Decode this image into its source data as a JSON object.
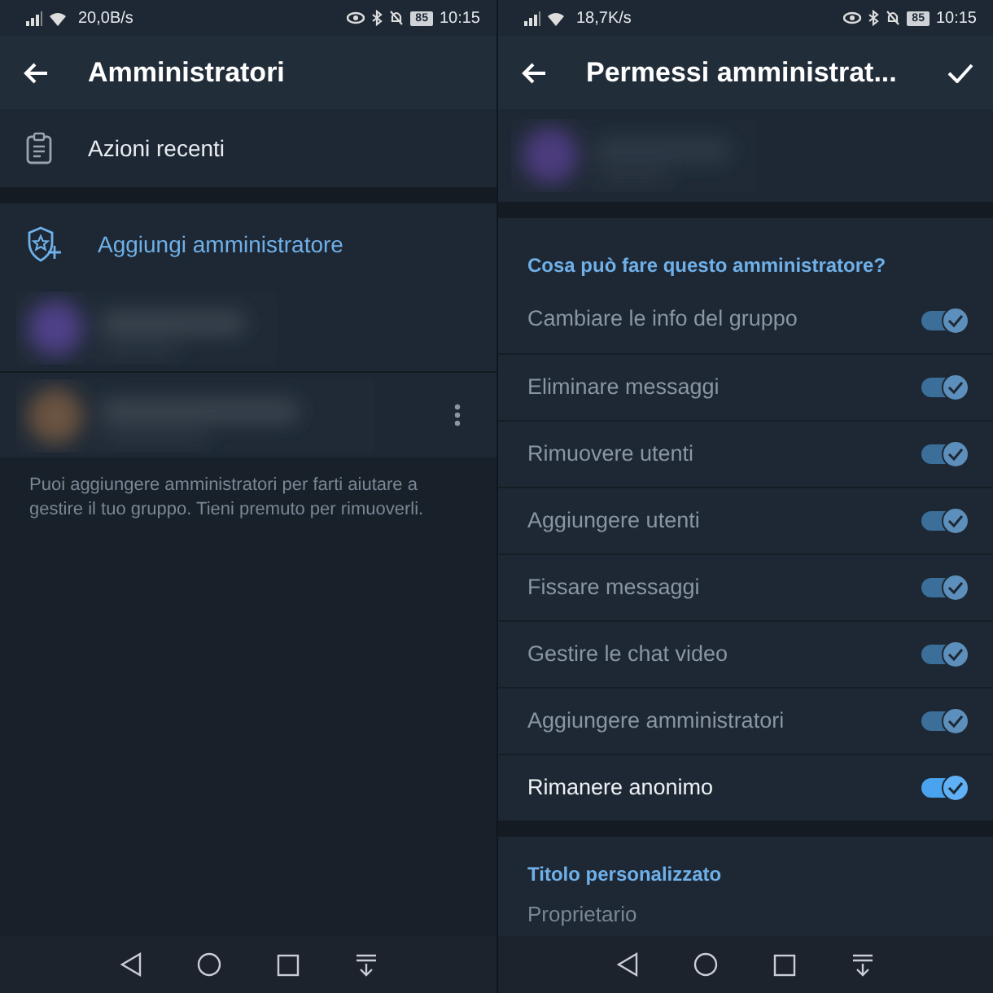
{
  "screens": [
    {
      "status_bar": {
        "speed": "20,0B/s",
        "battery": "85",
        "time": "10:15"
      },
      "header": {
        "title": "Amministratori",
        "confirm": false
      },
      "recent_actions": {
        "label": "Azioni recenti"
      },
      "add_admin": {
        "label": "Aggiungi amministratore"
      },
      "admins": [
        {
          "kind": "picture",
          "has_menu": false
        },
        {
          "kind": "picture",
          "has_menu": true
        }
      ],
      "hint": "Puoi aggiungere amministratori per farti aiutare a gestire il tuo gruppo. Tieni premuto per rimuoverli."
    },
    {
      "status_bar": {
        "speed": "18,7K/s",
        "battery": "85",
        "time": "10:15"
      },
      "header": {
        "title": "Permessi amministrat...",
        "confirm": true
      },
      "profile": {
        "kind": "picture"
      },
      "permissions_title": "Cosa può fare questo amministratore?",
      "permissions": [
        {
          "label": "Cambiare le info del gruppo",
          "on": true,
          "disabled": true
        },
        {
          "label": "Eliminare messaggi",
          "on": true,
          "disabled": true
        },
        {
          "label": "Rimuovere utenti",
          "on": true,
          "disabled": true
        },
        {
          "label": "Aggiungere utenti",
          "on": true,
          "disabled": true
        },
        {
          "label": "Fissare messaggi",
          "on": true,
          "disabled": true
        },
        {
          "label": "Gestire le chat video",
          "on": true,
          "disabled": true
        },
        {
          "label": "Aggiungere amministratori",
          "on": true,
          "disabled": true
        },
        {
          "label": "Rimanere anonimo",
          "on": true,
          "disabled": false
        }
      ],
      "custom_title": {
        "heading": "Titolo personalizzato",
        "placeholder": "Proprietario"
      }
    }
  ]
}
